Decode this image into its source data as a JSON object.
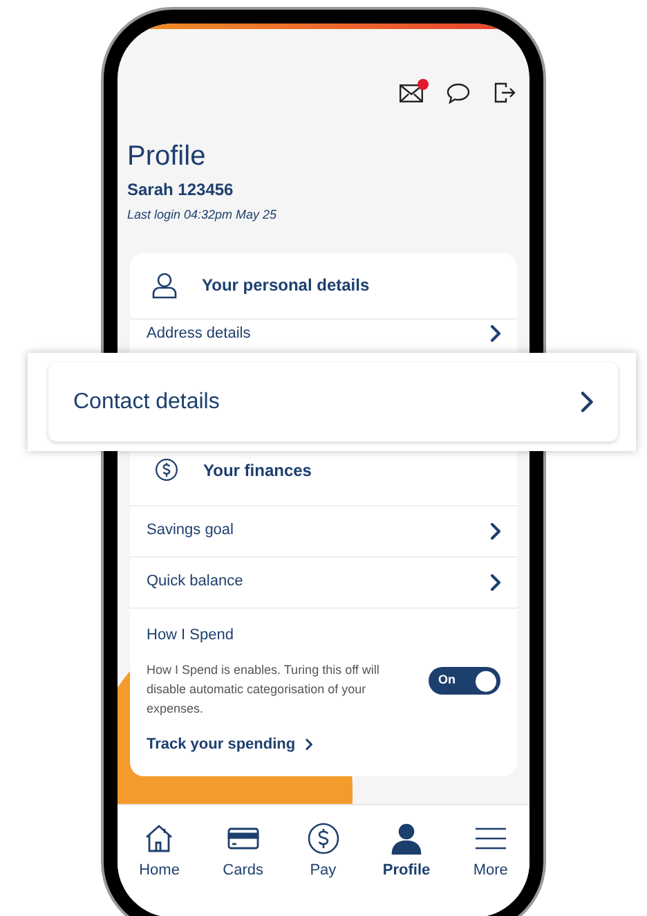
{
  "header": {
    "has_new_mail": true
  },
  "title": "Profile",
  "user": "Sarah 123456",
  "last_login": "Last login 04:32pm May 25",
  "personal": {
    "heading": "Your personal details",
    "rows": [
      {
        "label": "Address details"
      }
    ]
  },
  "callout": {
    "label": "Contact details"
  },
  "finances": {
    "heading": "Your finances",
    "rows": [
      {
        "label": "Savings goal"
      },
      {
        "label": "Quick balance"
      }
    ]
  },
  "how_i_spend": {
    "heading": "How I Spend",
    "text": "How I Spend is enables. Turing this off will disable automatic categorisation of your expenses.",
    "toggle": {
      "on": true,
      "label": "On"
    },
    "link": "Track your spending"
  },
  "nav": [
    {
      "label": "Home",
      "kind": "home",
      "selected": false
    },
    {
      "label": "Cards",
      "kind": "cards",
      "selected": false
    },
    {
      "label": "Pay",
      "kind": "pay",
      "selected": false
    },
    {
      "label": "Profile",
      "kind": "profile",
      "selected": true
    },
    {
      "label": "More",
      "kind": "more",
      "selected": false
    }
  ]
}
